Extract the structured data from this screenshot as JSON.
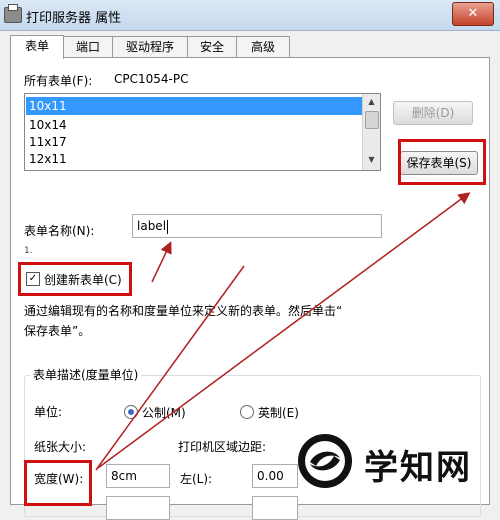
{
  "window": {
    "title": "打印服务器 属性",
    "close": "✕"
  },
  "tabs": [
    "表单",
    "端口",
    "驱动程序",
    "安全",
    "高级"
  ],
  "forms": {
    "all_forms_label": "所有表单(F):",
    "computer": "CPC1054-PC",
    "list_items": [
      "10x11",
      "10x14",
      "11x17",
      "12x11"
    ],
    "delete_button": "删除(D)",
    "save_button": "保存表单(S)",
    "form_name_label": "表单名称(N):",
    "form_name_value": "label",
    "step_number": "1.",
    "create_new_label": "创建新表单(C)",
    "create_new_checked": true,
    "description_line1": "通过编辑现有的名称和度量单位来定义新的表单。然后单击“",
    "description_line2": "保存表单”。",
    "group_title": "表单描述(度量单位)",
    "units_label": "单位:",
    "metric_label": "公制(M)",
    "imperial_label": "英制(E)",
    "paper_size_label": "纸张大小:",
    "print_area_label": "打印机区域边距:",
    "width_label": "宽度(W):",
    "width_value": "8cm",
    "left_label": "左(L):",
    "left_value": "0.00"
  },
  "watermark": {
    "text": "学知网"
  },
  "colors": {
    "highlight": "#d01010",
    "selection": "#3399ff",
    "arrow": "#b02020"
  }
}
